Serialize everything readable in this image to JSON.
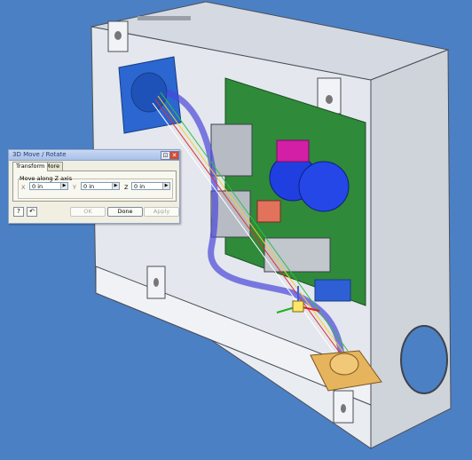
{
  "dialog": {
    "title": "3D Move / Rotate",
    "tabs": [
      "Transform",
      "More"
    ],
    "group_label": "Move along Z axis",
    "fields": [
      {
        "axis": "X",
        "value": "0 in"
      },
      {
        "axis": "Y",
        "value": "0 in"
      },
      {
        "axis": "Z",
        "value": "0 in"
      }
    ],
    "buttons": {
      "ok": "OK",
      "done": "Done",
      "apply": "Apply"
    }
  },
  "colors": {
    "viewport_bg": "#4c80c5",
    "housing": "#dfe3ea",
    "pcb": "#2f8a3a"
  }
}
